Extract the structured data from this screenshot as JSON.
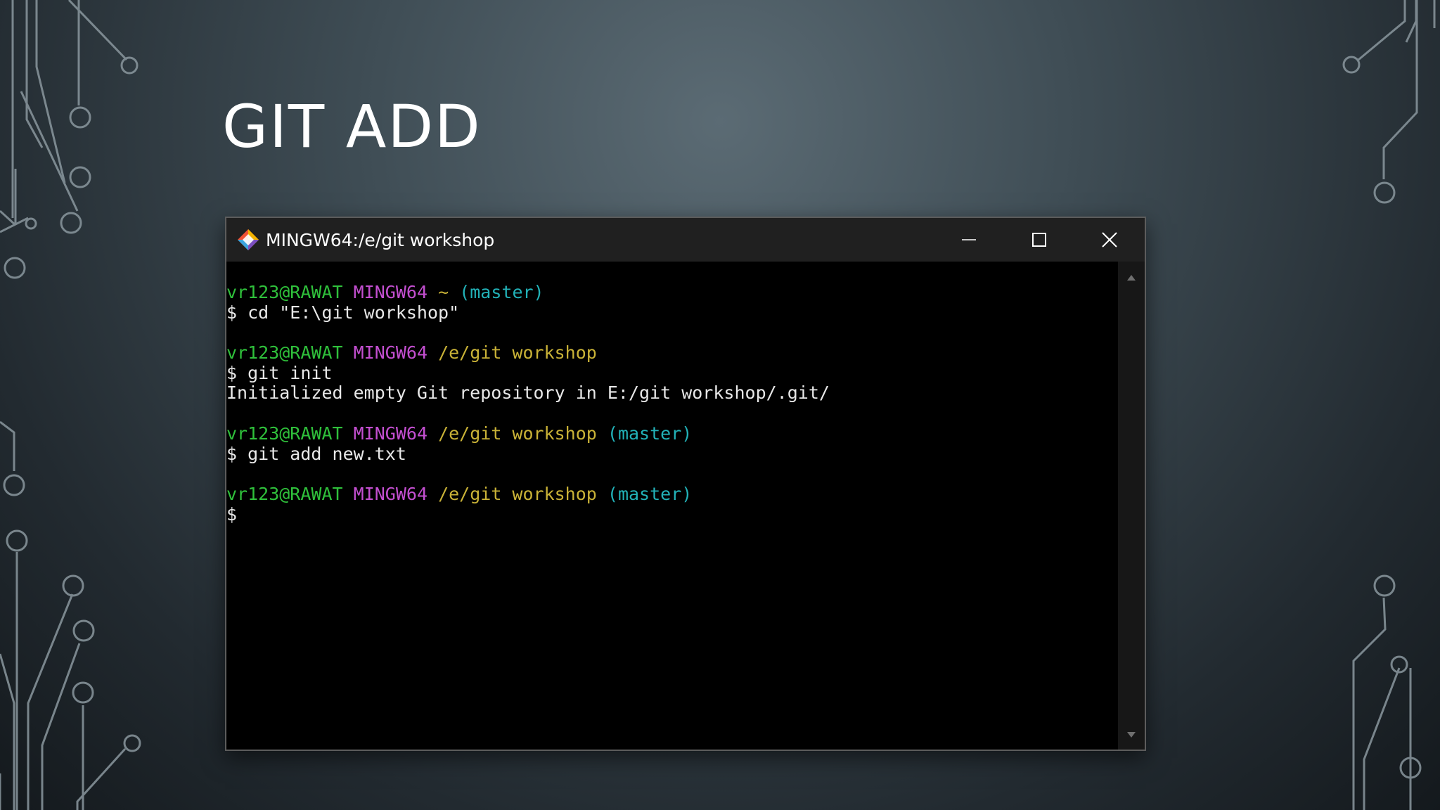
{
  "slide": {
    "title": "GIT ADD"
  },
  "window": {
    "title": "MINGW64:/e/git workshop",
    "controls": {
      "minimize": "minimize-icon",
      "maximize": "maximize-icon",
      "close": "close-icon"
    }
  },
  "colors": {
    "user_host": "#2fc03b",
    "system": "#c34fd0",
    "path": "#c9b237",
    "branch": "#22b2b8",
    "text": "#e8e8e8"
  },
  "terminal": {
    "blocks": [
      {
        "prompt": {
          "user": "vr123@RAWAT",
          "system": "MINGW64",
          "path": "~",
          "branch": "(master)"
        },
        "command": "$ cd \"E:\\git workshop\"",
        "output": ""
      },
      {
        "prompt": {
          "user": "vr123@RAWAT",
          "system": "MINGW64",
          "path": "/e/git workshop",
          "branch": ""
        },
        "command": "$ git init",
        "output": "Initialized empty Git repository in E:/git workshop/.git/"
      },
      {
        "prompt": {
          "user": "vr123@RAWAT",
          "system": "MINGW64",
          "path": "/e/git workshop",
          "branch": "(master)"
        },
        "command": "$ git add new.txt",
        "output": ""
      },
      {
        "prompt": {
          "user": "vr123@RAWAT",
          "system": "MINGW64",
          "path": "/e/git workshop",
          "branch": "(master)"
        },
        "command": "$",
        "output": ""
      }
    ]
  }
}
